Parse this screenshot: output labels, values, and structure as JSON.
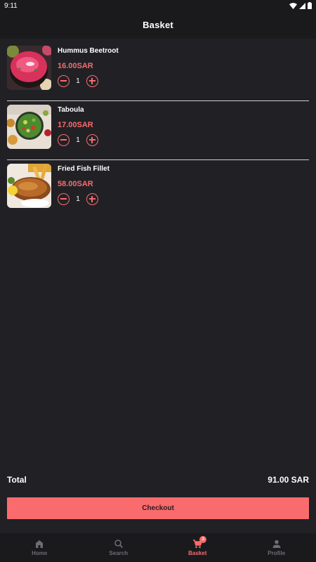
{
  "status_bar": {
    "time": "9:11"
  },
  "header": {
    "title": "Basket"
  },
  "basket": {
    "items": [
      {
        "name": "Hummus Beetroot",
        "price": "16.00SAR",
        "quantity": "1"
      },
      {
        "name": "Taboula",
        "price": "17.00SAR",
        "quantity": "1"
      },
      {
        "name": "Fried Fish Fillet",
        "price": "58.00SAR",
        "quantity": "1"
      }
    ]
  },
  "summary": {
    "total_label": "Total",
    "total_value": "91.00 SAR"
  },
  "checkout": {
    "label": "Checkout"
  },
  "nav": {
    "items": [
      {
        "label": "Home",
        "icon": "home-icon"
      },
      {
        "label": "Search",
        "icon": "search-icon"
      },
      {
        "label": "Basket",
        "icon": "cart-icon",
        "badge": "3"
      },
      {
        "label": "Profile",
        "icon": "person-icon"
      }
    ]
  },
  "colors": {
    "accent": "#fa6b6d",
    "background": "#212125",
    "bar": "#1a1a1d"
  }
}
